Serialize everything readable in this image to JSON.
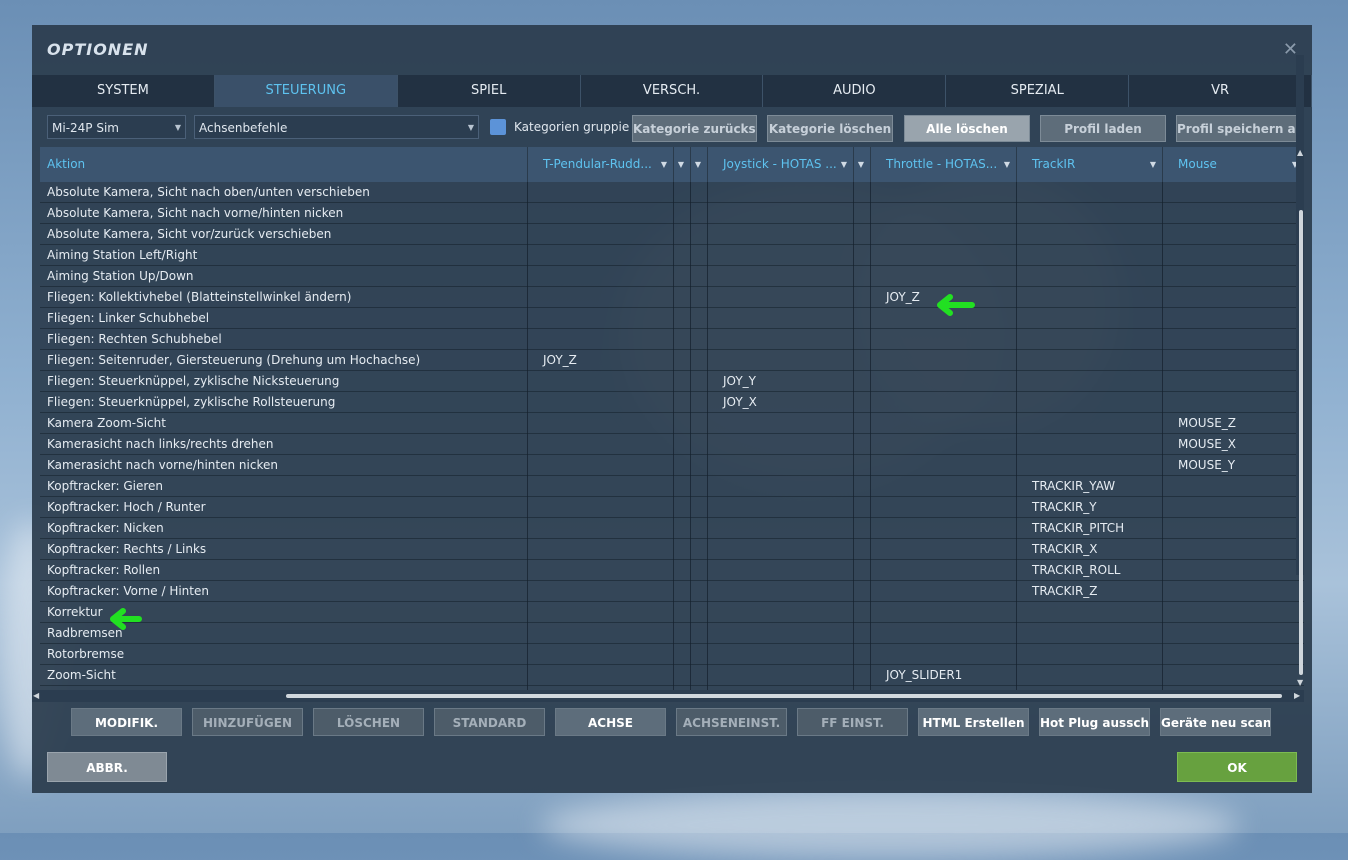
{
  "dialog": {
    "title": "OPTIONEN"
  },
  "tabs": [
    {
      "label": "SYSTEM"
    },
    {
      "label": "STEUERUNG",
      "active": true
    },
    {
      "label": "SPIEL"
    },
    {
      "label": "VERSCH."
    },
    {
      "label": "AUDIO"
    },
    {
      "label": "SPEZIAL"
    },
    {
      "label": "VR"
    }
  ],
  "toolbar": {
    "aircraft_select": "Mi-24P Sim",
    "category_select": "Achsenbefehle",
    "group_checkbox_label": "Kategorien gruppieren",
    "group_checkbox_checked": false,
    "reset_category": "Kategorie zurücksetzen",
    "clear_category": "Kategorie löschen",
    "clear_all": "Alle löschen",
    "load_profile": "Profil laden",
    "save_profile_as": "Profil speichern als"
  },
  "grid": {
    "columns": [
      "Aktion",
      "T-Pendular-Rudd...",
      "",
      "",
      "Joystick - HOTAS ...",
      "",
      "Throttle - HOTAS...",
      "TrackIR",
      "Mouse"
    ],
    "rows": [
      {
        "action": "Absolute Kamera, Sicht nach oben/unten verschieben",
        "rudder": "",
        "joystick": "",
        "throttle": "",
        "trackir": "",
        "mouse": ""
      },
      {
        "action": "Absolute Kamera, Sicht nach vorne/hinten nicken",
        "rudder": "",
        "joystick": "",
        "throttle": "",
        "trackir": "",
        "mouse": ""
      },
      {
        "action": "Absolute Kamera, Sicht vor/zurück verschieben",
        "rudder": "",
        "joystick": "",
        "throttle": "",
        "trackir": "",
        "mouse": ""
      },
      {
        "action": "Aiming Station Left/Right",
        "rudder": "",
        "joystick": "",
        "throttle": "",
        "trackir": "",
        "mouse": ""
      },
      {
        "action": "Aiming Station Up/Down",
        "rudder": "",
        "joystick": "",
        "throttle": "",
        "trackir": "",
        "mouse": ""
      },
      {
        "action": "Fliegen: Kollektivhebel (Blatteinstellwinkel ändern)",
        "rudder": "",
        "joystick": "",
        "throttle": "JOY_Z",
        "trackir": "",
        "mouse": ""
      },
      {
        "action": "Fliegen: Linker Schubhebel",
        "rudder": "",
        "joystick": "",
        "throttle": "",
        "trackir": "",
        "mouse": ""
      },
      {
        "action": "Fliegen: Rechten Schubhebel",
        "rudder": "",
        "joystick": "",
        "throttle": "",
        "trackir": "",
        "mouse": ""
      },
      {
        "action": "Fliegen: Seitenruder, Giersteuerung (Drehung um Hochachse)",
        "rudder": "JOY_Z",
        "joystick": "",
        "throttle": "",
        "trackir": "",
        "mouse": ""
      },
      {
        "action": "Fliegen: Steuerknüppel, zyklische Nicksteuerung",
        "rudder": "",
        "joystick": "JOY_Y",
        "throttle": "",
        "trackir": "",
        "mouse": ""
      },
      {
        "action": "Fliegen: Steuerknüppel, zyklische Rollsteuerung",
        "rudder": "",
        "joystick": "JOY_X",
        "throttle": "",
        "trackir": "",
        "mouse": ""
      },
      {
        "action": "Kamera Zoom-Sicht",
        "rudder": "",
        "joystick": "",
        "throttle": "",
        "trackir": "",
        "mouse": "MOUSE_Z"
      },
      {
        "action": "Kamerasicht nach links/rechts drehen",
        "rudder": "",
        "joystick": "",
        "throttle": "",
        "trackir": "",
        "mouse": "MOUSE_X"
      },
      {
        "action": "Kamerasicht nach vorne/hinten nicken",
        "rudder": "",
        "joystick": "",
        "throttle": "",
        "trackir": "",
        "mouse": "MOUSE_Y"
      },
      {
        "action": "Kopftracker: Gieren",
        "rudder": "",
        "joystick": "",
        "throttle": "",
        "trackir": "TRACKIR_YAW",
        "mouse": ""
      },
      {
        "action": "Kopftracker: Hoch / Runter",
        "rudder": "",
        "joystick": "",
        "throttle": "",
        "trackir": "TRACKIR_Y",
        "mouse": ""
      },
      {
        "action": "Kopftracker: Nicken",
        "rudder": "",
        "joystick": "",
        "throttle": "",
        "trackir": "TRACKIR_PITCH",
        "mouse": ""
      },
      {
        "action": "Kopftracker: Rechts / Links",
        "rudder": "",
        "joystick": "",
        "throttle": "",
        "trackir": "TRACKIR_X",
        "mouse": ""
      },
      {
        "action": "Kopftracker: Rollen",
        "rudder": "",
        "joystick": "",
        "throttle": "",
        "trackir": "TRACKIR_ROLL",
        "mouse": ""
      },
      {
        "action": "Kopftracker: Vorne / Hinten",
        "rudder": "",
        "joystick": "",
        "throttle": "",
        "trackir": "TRACKIR_Z",
        "mouse": ""
      },
      {
        "action": "Korrektur",
        "rudder": "",
        "joystick": "",
        "throttle": "",
        "trackir": "",
        "mouse": ""
      },
      {
        "action": "Radbremsen",
        "rudder": "",
        "joystick": "",
        "throttle": "",
        "trackir": "",
        "mouse": ""
      },
      {
        "action": "Rotorbremse",
        "rudder": "",
        "joystick": "",
        "throttle": "",
        "trackir": "",
        "mouse": ""
      },
      {
        "action": "Zoom-Sicht",
        "rudder": "",
        "joystick": "",
        "throttle": "JOY_SLIDER1",
        "trackir": "",
        "mouse": ""
      }
    ]
  },
  "bottom_buttons": [
    {
      "label": "MODIFIK.",
      "enabled": true
    },
    {
      "label": "HINZUFÜGEN",
      "enabled": false
    },
    {
      "label": "LÖSCHEN",
      "enabled": false
    },
    {
      "label": "STANDARD",
      "enabled": false
    },
    {
      "label": "ACHSE",
      "enabled": true
    },
    {
      "label": "ACHSENEINST.",
      "enabled": false
    },
    {
      "label": "FF EINST.",
      "enabled": false
    },
    {
      "label": "HTML Erstellen",
      "enabled": true
    },
    {
      "label": "Hot Plug ausschalten",
      "enabled": true
    },
    {
      "label": "Geräte neu scannen",
      "enabled": true
    }
  ],
  "footer": {
    "cancel": "ABBR.",
    "ok": "OK"
  },
  "colors": {
    "accent": "#5ec3f0",
    "ok_green": "#67a13f",
    "marker_green": "#22e022"
  },
  "icons": {
    "close": "close-icon",
    "dropdown": "chevron-down-icon",
    "marker": "arrow-left-icon"
  }
}
